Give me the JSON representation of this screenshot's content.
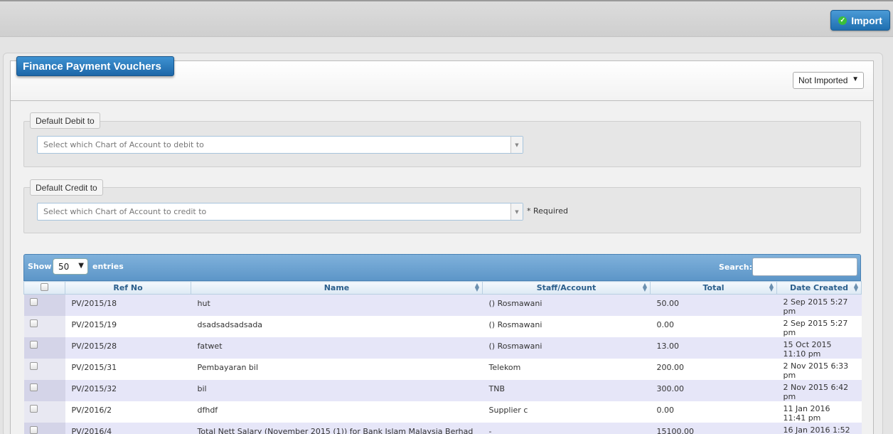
{
  "toolbar": {
    "import_label": "Import"
  },
  "panel": {
    "title": "Finance Payment Vouchers",
    "status_filter": "Not Imported"
  },
  "debit": {
    "legend": "Default Debit to",
    "placeholder": "Select which Chart of Account to debit to"
  },
  "credit": {
    "legend": "Default Credit to",
    "placeholder": "Select which Chart of Account to credit to",
    "required_note": "* Required"
  },
  "table": {
    "show_label": "Show",
    "page_length": "50",
    "entries_label": "entries",
    "search_label": "Search:",
    "columns": {
      "ref_no": "Ref No",
      "name": "Name",
      "staff_account": "Staff/Account",
      "total": "Total",
      "date_created": "Date Created"
    },
    "rows": [
      {
        "ref_no": "PV/2015/18",
        "name": "hut",
        "staff_account": "() Rosmawani",
        "total": "50.00",
        "date_created": "2 Sep 2015 5:27 pm"
      },
      {
        "ref_no": "PV/2015/19",
        "name": "dsadsadsadsada",
        "staff_account": "() Rosmawani",
        "total": "0.00",
        "date_created": "2 Sep 2015 5:27 pm"
      },
      {
        "ref_no": "PV/2015/28",
        "name": "fatwet",
        "staff_account": "() Rosmawani",
        "total": "13.00",
        "date_created": "15 Oct 2015 11:10 pm"
      },
      {
        "ref_no": "PV/2015/31",
        "name": "Pembayaran bil",
        "staff_account": "Telekom",
        "total": "200.00",
        "date_created": "2 Nov 2015 6:33 pm"
      },
      {
        "ref_no": "PV/2015/32",
        "name": "bil",
        "staff_account": "TNB",
        "total": "300.00",
        "date_created": "2 Nov 2015 6:42 pm"
      },
      {
        "ref_no": "PV/2016/2",
        "name": "dfhdf",
        "staff_account": "Supplier c",
        "total": "0.00",
        "date_created": "11 Jan 2016 11:41 pm"
      },
      {
        "ref_no": "PV/2016/4",
        "name": "Total Nett Salary (November 2015 (1)) for Bank Islam Malaysia Berhad",
        "staff_account": "-",
        "total": "15100.00",
        "date_created": "16 Jan 2016 1:52"
      }
    ]
  }
}
